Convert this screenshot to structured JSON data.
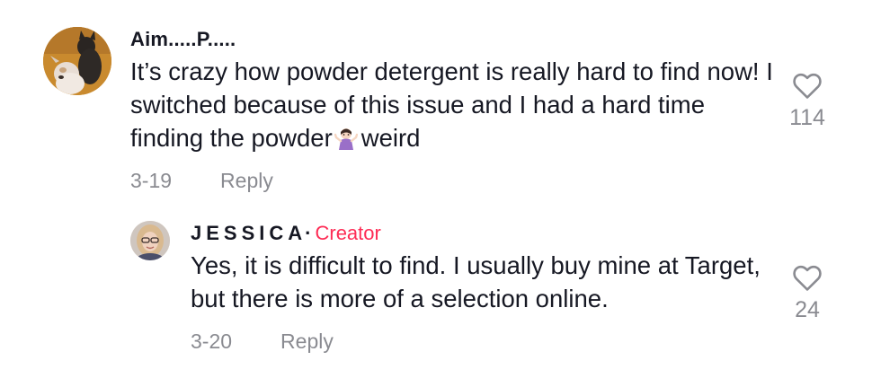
{
  "comments": [
    {
      "username": "Aim.....P.....",
      "text_part1": "It’s crazy how powder detergent is really hard to find now! I switched because of this issue and I had a hard time finding the powder",
      "text_part2": "weird",
      "emoji": "woman-shrugging-emoji",
      "date": "3-19",
      "reply_label": "Reply",
      "likes": "114",
      "avatar": "dog-avatar"
    },
    {
      "username": "JESSICA",
      "separator": "·",
      "badge": "Creator",
      "text": "Yes, it is difficult to find. I usually buy mine at Target, but there is more of a selection online.",
      "date": "3-20",
      "reply_label": "Reply",
      "likes": "24",
      "avatar": "user-avatar"
    }
  ],
  "colors": {
    "text": "#161823",
    "secondary": "#8a8b91",
    "creator_badge": "#fe2c55"
  }
}
